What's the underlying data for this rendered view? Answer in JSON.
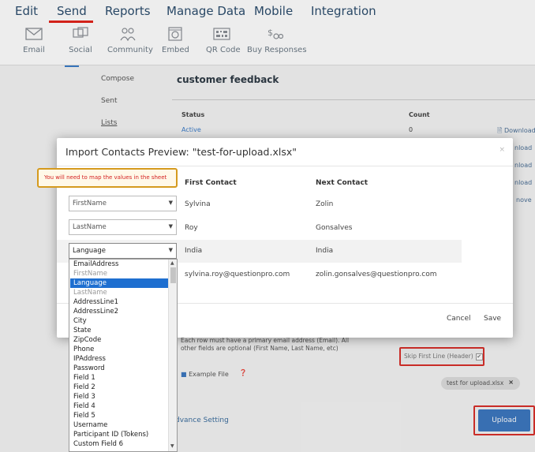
{
  "nav": {
    "items": [
      "Edit",
      "Send",
      "Reports",
      "Manage Data",
      "Mobile",
      "Integration"
    ],
    "active": "Send"
  },
  "toolbar": {
    "items": [
      {
        "label": "Email",
        "icon": "envelope-icon"
      },
      {
        "label": "Social",
        "icon": "social-icon"
      },
      {
        "label": "Community",
        "icon": "community-icon"
      },
      {
        "label": "Embed",
        "icon": "embed-icon"
      },
      {
        "label": "QR Code",
        "icon": "qr-code-icon"
      },
      {
        "label": "Buy Responses",
        "icon": "buy-responses-icon"
      }
    ]
  },
  "background": {
    "side_menu": [
      "Compose",
      "Sent",
      "Lists"
    ],
    "title": "customer feedback",
    "table_headers": {
      "status": "Status",
      "count": "Count"
    },
    "table_row": {
      "status": "Active",
      "count": "0",
      "action": "Download"
    },
    "right_links": [
      "nload",
      "nload",
      "nload",
      "nove"
    ],
    "instructions": "Each row must have a primary email address (Email). All other fields are optional (First Name, Last Name, etc)",
    "example_file": "Example File",
    "advance_setting": "dvance Setting",
    "skip_first_line": "Skip First Line (Header)",
    "file_chip": "test for upload.xlsx",
    "file_chip_remove": "×",
    "upload": "Upload"
  },
  "modal": {
    "title": "Import Contacts Preview: \"test-for-upload.xlsx\"",
    "close": "×",
    "headers": {
      "first": "First Contact",
      "next": "Next Contact"
    },
    "rows": [
      {
        "field": "FirstName",
        "first": "Sylvina",
        "next": "Zolin"
      },
      {
        "field": "LastName",
        "first": "Roy",
        "next": "Gonsalves"
      },
      {
        "field": "Language",
        "first": "India",
        "next": "India"
      },
      {
        "field": "",
        "first": "sylvina.roy@questionpro.com",
        "next": "zolin.gonsalves@questionpro.com"
      }
    ],
    "cancel": "Cancel",
    "save": "Save",
    "callout": "You will need to map the values in the sheet"
  },
  "dropdown": {
    "selected": "Language",
    "options": [
      "EmailAddress",
      "FirstName",
      "Language",
      "LastName",
      "AddressLine1",
      "AddressLine2",
      "City",
      "State",
      "ZipCode",
      "Phone",
      "IPAddress",
      "Password",
      "Field 1",
      "Field 2",
      "Field 3",
      "Field 4",
      "Field 5",
      "Username",
      "Participant ID (Tokens)",
      "Custom Field 6"
    ]
  },
  "colors": {
    "accent": "#3d78c0",
    "highlight": "#d9302a",
    "selected_option": "#1e6fd0",
    "callout_border": "#d59a1e"
  }
}
